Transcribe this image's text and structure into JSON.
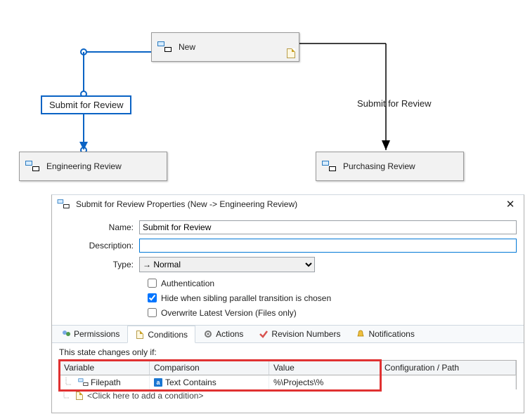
{
  "states": {
    "new": "New",
    "engineering": "Engineering Review",
    "purchasing": "Purchasing Review"
  },
  "transitions": {
    "left_label": "Submit for Review",
    "right_label": "Submit for Review"
  },
  "dialog": {
    "title": "Submit for Review Properties (New -> Engineering Review)",
    "name_label": "Name:",
    "name_value": "Submit for Review",
    "description_label": "Description:",
    "description_value": "",
    "type_label": "Type:",
    "type_value": "→ Normal",
    "chk_authentication": "Authentication",
    "chk_hide_sibling": "Hide when sibling parallel transition is chosen",
    "chk_overwrite": "Overwrite Latest Version (Files only)",
    "authentication_checked": false,
    "hide_sibling_checked": true,
    "overwrite_checked": false
  },
  "tabs": {
    "permissions": "Permissions",
    "conditions": "Conditions",
    "actions": "Actions",
    "revision_numbers": "Revision Numbers",
    "notifications": "Notifications",
    "active": "conditions"
  },
  "conditions": {
    "intro": "This state changes only if:",
    "columns": {
      "variable": "Variable",
      "comparison": "Comparison",
      "value": "Value",
      "config": "Configuration / Path"
    },
    "rows": [
      {
        "variable": "Filepath",
        "comparison": "Text Contains",
        "value": "%\\Projects\\%",
        "config": ""
      }
    ],
    "add_hint": "<Click here to add a condition>"
  }
}
